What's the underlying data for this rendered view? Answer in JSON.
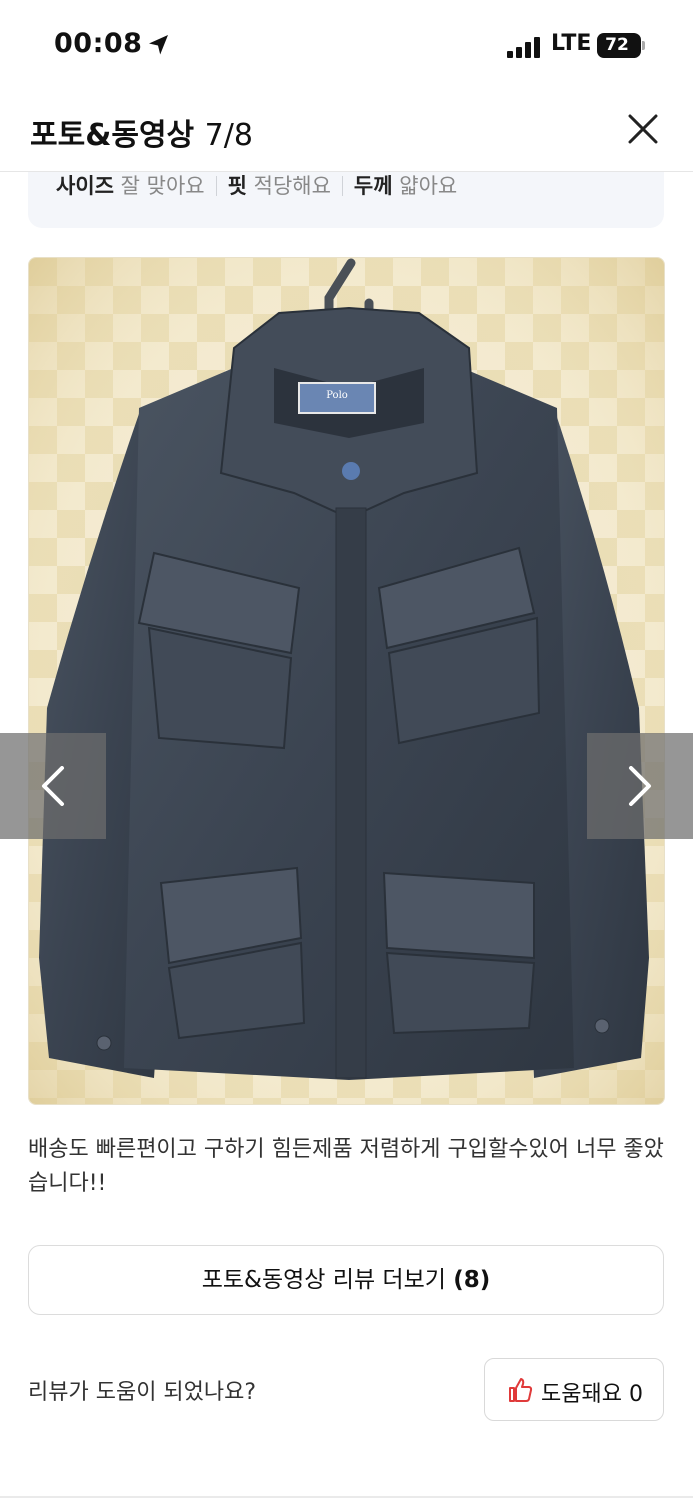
{
  "status_bar": {
    "time": "00:08",
    "network": "LTE",
    "battery": "72"
  },
  "header": {
    "title": "포토&동영상",
    "counter": "7/8"
  },
  "summary": {
    "items": [
      {
        "key": "사이즈",
        "value": "잘 맞아요"
      },
      {
        "key": "핏",
        "value": "적당해요"
      },
      {
        "key": "두께",
        "value": "얇아요"
      }
    ]
  },
  "photo": {
    "label_text": "Polo"
  },
  "review": {
    "text": "배송도 빠른편이고 구하기 힘든제품 저렴하게 구입할수있어 너무 좋았습니다!!"
  },
  "more_button": {
    "label": "포토&동영상 리뷰 더보기",
    "count": "(8)"
  },
  "helpful": {
    "question": "리뷰가 도움이 되었나요?",
    "button_label": "도움돼요 0"
  },
  "colors": {
    "accent_thumb": "#e03a3a",
    "jacket": "#3a4350",
    "background_check": "#f0e6c4"
  }
}
